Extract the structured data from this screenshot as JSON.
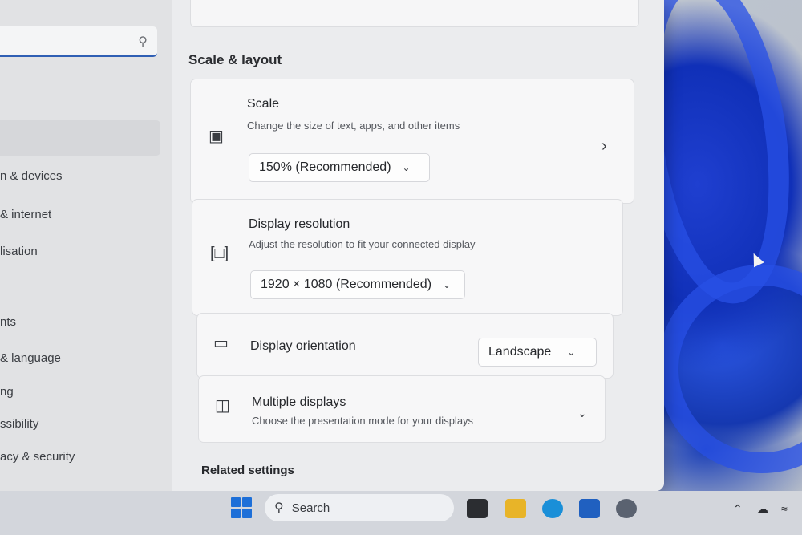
{
  "sidebar": {
    "search_icon": "search-icon",
    "items": [
      {
        "label": "n & devices"
      },
      {
        "label": "& internet"
      },
      {
        "label": "lisation"
      },
      {
        "label": "nts"
      },
      {
        "label": "& language"
      },
      {
        "label": "ng"
      },
      {
        "label": "ssibility"
      },
      {
        "label": "acy & security"
      }
    ]
  },
  "main": {
    "section_title": "Scale & layout",
    "scale": {
      "title": "Scale",
      "description": "Change the size of text, apps, and other items",
      "value": "150% (Recommended)"
    },
    "resolution": {
      "title": "Display resolution",
      "description": "Adjust the resolution to fit your connected display",
      "value": "1920 × 1080 (Recommended)"
    },
    "orientation": {
      "title": "Display orientation",
      "value": "Landscape"
    },
    "multiple_displays": {
      "title": "Multiple displays",
      "description": "Choose the presentation mode for your displays"
    },
    "related_settings": "Related settings"
  },
  "taskbar": {
    "search_label": "Search"
  },
  "colors": {
    "accent": "#2f5fb4",
    "start_blue": "#1d6fd8",
    "wallpaper_blue": "#1f3fd0"
  }
}
